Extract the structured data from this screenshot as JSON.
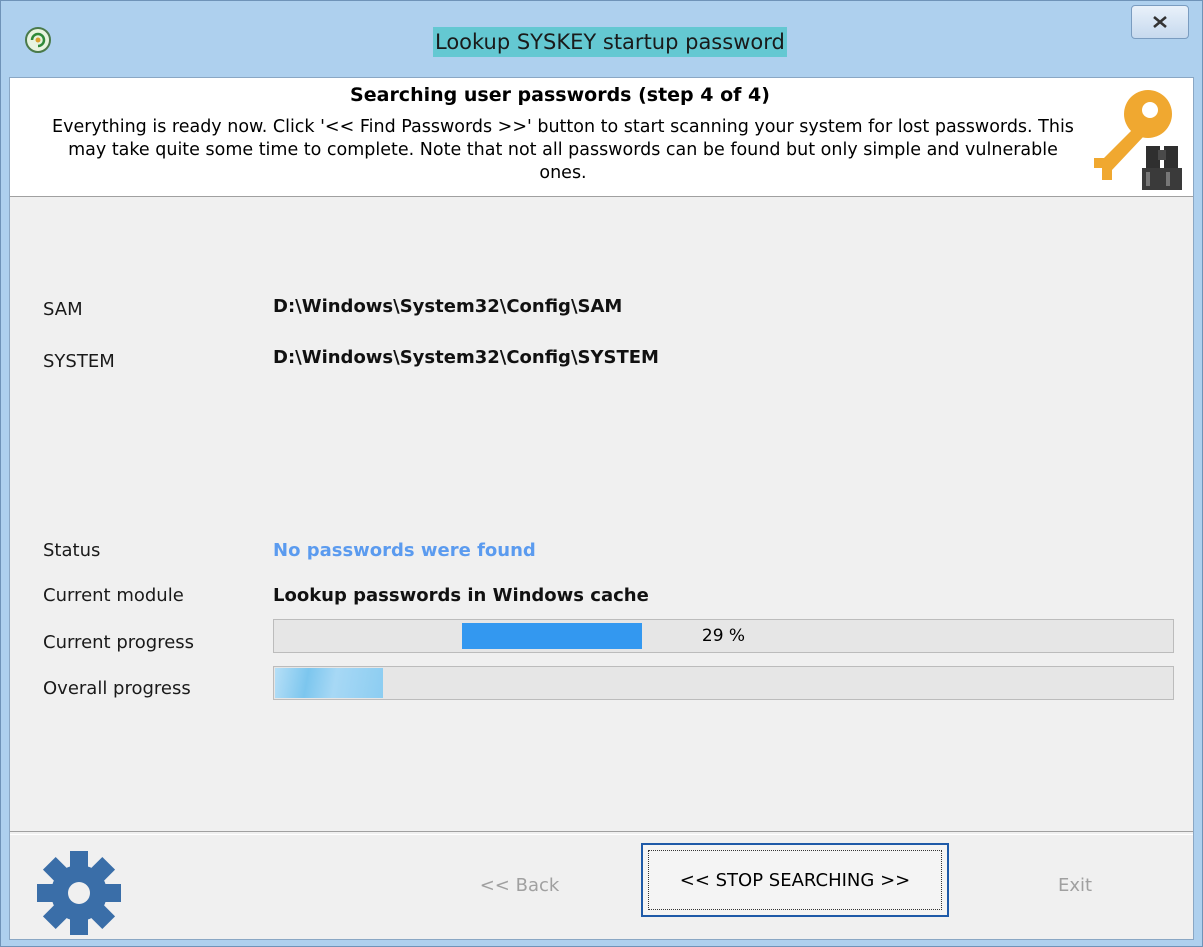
{
  "window": {
    "title": "Lookup SYSKEY startup password"
  },
  "header": {
    "title": "Searching user passwords (step 4 of 4)",
    "description": "Everything is ready now. Click '<< Find Passwords >>' button to start scanning your system for lost passwords. This may take quite some time to complete. Note that not all passwords can be found but only simple and vulnerable ones.",
    "icon": "key-binoculars-icon"
  },
  "files": {
    "sam_label": "SAM",
    "sam_path": "D:\\Windows\\System32\\Config\\SAM",
    "system_label": "SYSTEM",
    "system_path": "D:\\Windows\\System32\\Config\\SYSTEM"
  },
  "status": {
    "status_label": "Status",
    "status_value": "No passwords were found",
    "status_color": "#5b9bef",
    "module_label": "Current module",
    "module_value": "Lookup passwords in Windows cache",
    "current_progress_label": "Current progress",
    "current_progress_text": "29 %",
    "overall_progress_label": "Overall progress",
    "overall_progress_fraction": 0.12
  },
  "footer": {
    "back_label": "<< Back",
    "stop_label": "<< STOP SEARCHING >>",
    "exit_label": "Exit",
    "icon": "gear-icon"
  }
}
